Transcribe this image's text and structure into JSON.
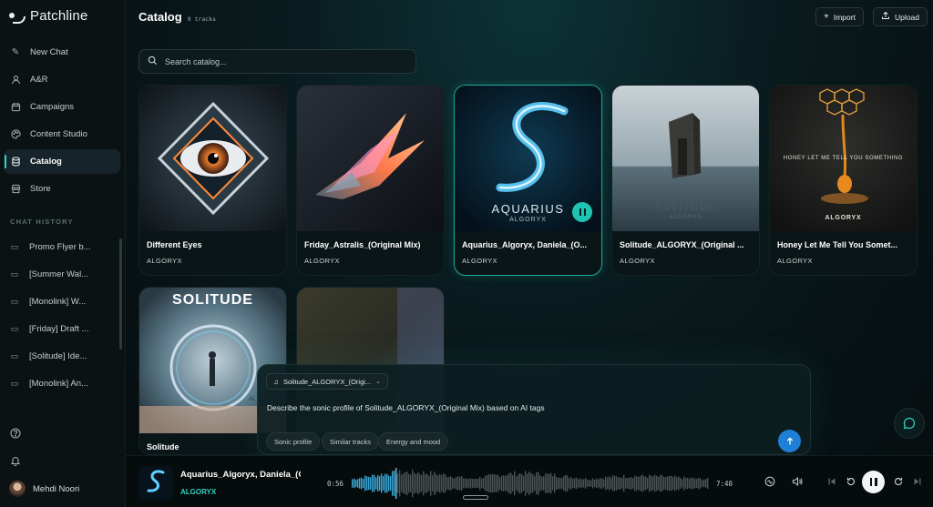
{
  "app": {
    "name": "Patchline"
  },
  "sidebar": {
    "nav": [
      {
        "label": "New Chat",
        "icon": "edit-icon"
      },
      {
        "label": "A&R",
        "icon": "user-icon"
      },
      {
        "label": "Campaigns",
        "icon": "calendar-icon"
      },
      {
        "label": "Content Studio",
        "icon": "palette-icon"
      },
      {
        "label": "Catalog",
        "icon": "database-icon",
        "active": true
      },
      {
        "label": "Store",
        "icon": "store-icon"
      }
    ],
    "history_title": "CHAT HISTORY",
    "history": [
      {
        "label": "Promo Flyer b..."
      },
      {
        "label": "[Summer Wal..."
      },
      {
        "label": "[Monolink] W..."
      },
      {
        "label": "[Friday] Draft ..."
      },
      {
        "label": "[Solitude] Ide..."
      },
      {
        "label": "[Monolink] An..."
      }
    ],
    "user": {
      "name": "Mehdi Noori"
    }
  },
  "header": {
    "title": "Catalog",
    "track_count": "9 tracks",
    "import_label": "Import",
    "upload_label": "Upload"
  },
  "search": {
    "placeholder": "Search catalog..."
  },
  "tracks": [
    {
      "title": "Different Eyes",
      "artist": "ALGORYX"
    },
    {
      "title": "Friday_Astralis_(Original Mix)",
      "artist": "ALGORYX"
    },
    {
      "title": "Aquarius_Algoryx, Daniela_(O...",
      "artist": "ALGORYX",
      "playing": true,
      "art_title": "AQUARIUS",
      "art_sub": "ALGORYX"
    },
    {
      "title": "Solitude_ALGORYX_(Original ...",
      "artist": "ALGORYX",
      "art_title": "SOLITUDE",
      "art_sub": "ALGORYX"
    },
    {
      "title": "Honey Let Me Tell You Somet...",
      "artist": "ALGORYX",
      "art_title": "HONEY LET ME TELL YOU SOMETHING",
      "art_sub": "ALGORYX"
    },
    {
      "title": "Solitude",
      "artist": "",
      "art_title": "SOLITUDE",
      "art_sub": "AL"
    },
    {
      "title": "",
      "artist": ""
    }
  ],
  "chat": {
    "context_chip": "Solitude_ALGORYX_(Origi...",
    "message": "Describe the sonic profile of Solitude_ALGORYX_(Original Mix) based on AI tags",
    "suggestions": [
      "Sonic profile",
      "Similar tracks",
      "Energy and mood"
    ]
  },
  "player": {
    "title": "Aquarius_Algoryx, Daniela_(O",
    "artist": "ALGORYX",
    "elapsed": "0:56",
    "duration": "7:40",
    "progress": 0.123,
    "art_title": "AQUARIUS"
  },
  "colors": {
    "accent": "#2ed3c0",
    "send": "#1e7fd6",
    "background": "#071012"
  }
}
